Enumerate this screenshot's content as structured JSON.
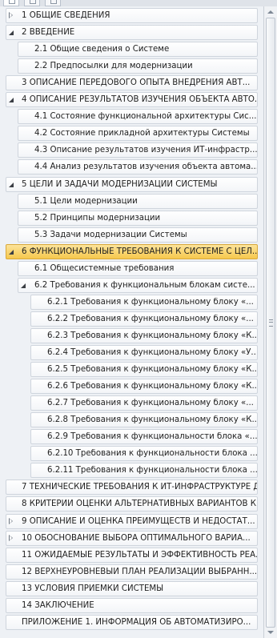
{
  "tabs": [
    "pages-tab",
    "thumbnails-tab",
    "results-tab"
  ],
  "rows": [
    {
      "label": "1 ОБЩИЕ СВЕДЕНИЯ",
      "level": 0,
      "toggle": "collapsed"
    },
    {
      "label": "2 ВВЕДЕНИЕ",
      "level": 0,
      "toggle": "expanded"
    },
    {
      "label": "2.1 Общие сведения о Системе",
      "level": 1,
      "toggle": "none"
    },
    {
      "label": "2.2 Предпосылки для модернизации",
      "level": 1,
      "toggle": "none"
    },
    {
      "label": "3 ОПИСАНИЕ ПЕРЕДОВОГО ОПЫТА ВНЕДРЕНИЯ АВТ...",
      "level": 0,
      "toggle": "none"
    },
    {
      "label": "4 ОПИСАНИЕ РЕЗУЛЬТАТОВ ИЗУЧЕНИЯ ОБЪЕКТА АВТО...",
      "level": 0,
      "toggle": "expanded"
    },
    {
      "label": "4.1 Состояние функциональной архитектуры Сис...",
      "level": 1,
      "toggle": "none"
    },
    {
      "label": "4.2 Состояние прикладной архитектуры Системы",
      "level": 1,
      "toggle": "none"
    },
    {
      "label": "4.3 Описание результатов изучения ИТ-инфрастр...",
      "level": 1,
      "toggle": "none"
    },
    {
      "label": "4.4 Анализ результатов изучения объекта автома...",
      "level": 1,
      "toggle": "none"
    },
    {
      "label": "5 ЦЕЛИ И ЗАДАЧИ МОДЕРНИЗАЦИИ СИСТЕМЫ",
      "level": 0,
      "toggle": "expanded"
    },
    {
      "label": "5.1 Цели модернизации",
      "level": 1,
      "toggle": "none"
    },
    {
      "label": "5.2 Принципы модернизации",
      "level": 1,
      "toggle": "none"
    },
    {
      "label": "5.3 Задачи модернизации Системы",
      "level": 1,
      "toggle": "none"
    },
    {
      "label": "6 ФУНКЦИОНАЛЬНЫЕ ТРЕБОВАНИЯ К СИСТЕМЕ С ЦЕЛ...",
      "level": 0,
      "toggle": "expanded",
      "selected": true
    },
    {
      "label": "6.1 Общесистемные требования",
      "level": 1,
      "toggle": "none"
    },
    {
      "label": "6.2 Требования к функциональным блокам систе...",
      "level": 1,
      "toggle": "expanded"
    },
    {
      "label": "6.2.1 Требования к функциональному блоку «...",
      "level": 2,
      "toggle": "none"
    },
    {
      "label": "6.2.2 Требования к функциональному блоку «...",
      "level": 2,
      "toggle": "none"
    },
    {
      "label": "6.2.3 Требования к функциональному блоку «К...",
      "level": 2,
      "toggle": "none"
    },
    {
      "label": "6.2.4 Требования к функциональному блоку «У...",
      "level": 2,
      "toggle": "none"
    },
    {
      "label": "6.2.5 Требования к функциональному блоку «К...",
      "level": 2,
      "toggle": "none"
    },
    {
      "label": "6.2.6 Требования к функциональному блоку «К...",
      "level": 2,
      "toggle": "none"
    },
    {
      "label": "6.2.7 Требования к функциональному блоку «...",
      "level": 2,
      "toggle": "none"
    },
    {
      "label": "6.2.8 Требования к функциональному блоку «К...",
      "level": 2,
      "toggle": "none"
    },
    {
      "label": "6.2.9 Требования к функциональности блока «...",
      "level": 2,
      "toggle": "none"
    },
    {
      "label": "6.2.10 Требования к функциональности блока ...",
      "level": 2,
      "toggle": "none"
    },
    {
      "label": "6.2.11 Требования к функциональности блока ...",
      "level": 2,
      "toggle": "none"
    },
    {
      "label": "7 ТЕХНИЧЕСКИЕ ТРЕБОВАНИЯ К ИТ-ИНФРАСТРУКТУРЕ Д...",
      "level": 0,
      "toggle": "none"
    },
    {
      "label": "8 КРИТЕРИИ ОЦЕНКИ АЛЬТЕРНАТИВНЫХ ВАРИАНТОВ К...",
      "level": 0,
      "toggle": "none"
    },
    {
      "label": "9 ОПИСАНИЕ И ОЦЕНКА ПРЕИМУЩЕСТВ И НЕДОСТАТ...",
      "level": 0,
      "toggle": "collapsed"
    },
    {
      "label": "10 ОБОСНОВАНИЕ ВЫБОРА ОПТИМАЛЬНОГО ВАРИА...",
      "level": 0,
      "toggle": "collapsed"
    },
    {
      "label": "11 ОЖИДАЕМЫЕ РЕЗУЛЬТАТЫ И ЭФФЕКТИВНОСТЬ РЕА...",
      "level": 0,
      "toggle": "none"
    },
    {
      "label": "12 ВЕРХНЕУРОВНЕВЫЙ ПЛАН РЕАЛИЗАЦИИ ВЫБРАНН...",
      "level": 0,
      "toggle": "none"
    },
    {
      "label": "13 УСЛОВИЯ ПРИЕМКИ СИСТЕМЫ",
      "level": 0,
      "toggle": "none"
    },
    {
      "label": "14 ЗАКЛЮЧЕНИЕ",
      "level": 0,
      "toggle": "none"
    },
    {
      "label": "ПРИЛОЖЕНИЕ 1. ИНФОРМАЦИЯ ОБ АВТОМАТИЗИРО...",
      "level": 0,
      "toggle": "none"
    }
  ]
}
